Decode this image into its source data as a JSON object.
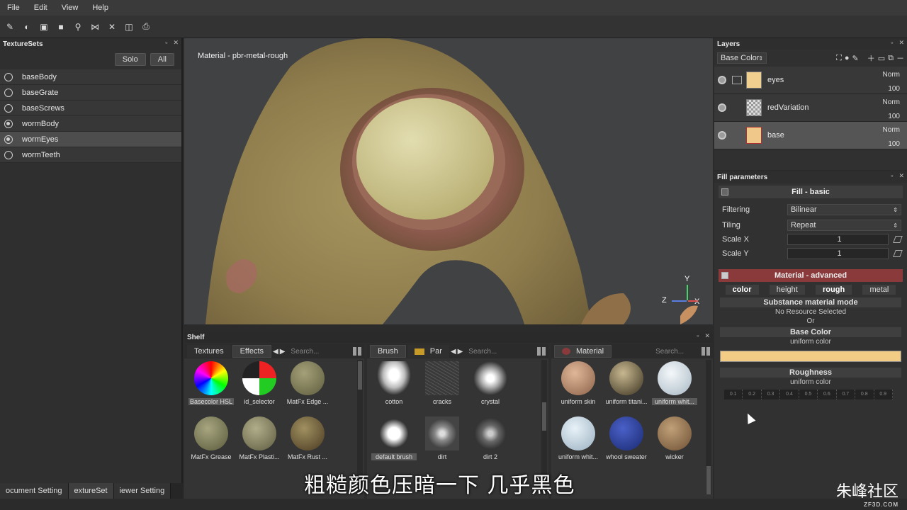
{
  "menu": [
    "File",
    "Edit",
    "View",
    "Help"
  ],
  "texturesets": {
    "title": "TextureSets",
    "solo_label": "Solo",
    "all_label": "All",
    "items": [
      {
        "label": "baseBody",
        "selected": false,
        "checked": false
      },
      {
        "label": "baseGrate",
        "selected": false,
        "checked": false
      },
      {
        "label": "baseScrews",
        "selected": false,
        "checked": false
      },
      {
        "label": "wormBody",
        "selected": false,
        "checked": true
      },
      {
        "label": "wormEyes",
        "selected": true,
        "checked": true
      },
      {
        "label": "wormTeeth",
        "selected": false,
        "checked": false
      }
    ]
  },
  "bottom_tabs": [
    "ocument Setting",
    "extureSet",
    "iewer Setting"
  ],
  "viewport": {
    "material_label": "Material - pbr-metal-rough",
    "axes": {
      "x": "X",
      "y": "Y",
      "z": "Z"
    }
  },
  "shelf": {
    "title": "Shelf",
    "col1": {
      "tabs": [
        "Textures",
        "Effects"
      ],
      "search": "Search...",
      "items": [
        "Basecolor HSL",
        "id_selector",
        "MatFx Edge ...",
        "MatFx Grease",
        "MatFx Plasti...",
        "MatFx Rust ..."
      ]
    },
    "col2": {
      "tabs": [
        "Brush",
        "Par"
      ],
      "search": "Search...",
      "items": [
        "cotton",
        "cracks",
        "crystal",
        "default brush",
        "dirt",
        "dirt 2"
      ]
    },
    "col3": {
      "tabs": [
        "Material"
      ],
      "search": "Search...",
      "items": [
        "uniform skin",
        "uniform titani...",
        "uniform whit...",
        "uniform whit...",
        "whool sweater",
        "wicker"
      ]
    }
  },
  "layers": {
    "title": "Layers",
    "channel": "Base Color",
    "rows": [
      {
        "name": "eyes",
        "blend": "Norm",
        "opacity": "100",
        "color": "#f1cf8f",
        "folder": true,
        "selected": false
      },
      {
        "name": "redVariation",
        "blend": "Norm",
        "opacity": "100",
        "color": "checker",
        "folder": false,
        "selected": false
      },
      {
        "name": "base",
        "blend": "Norm",
        "opacity": "100",
        "color": "#f0c98a",
        "folder": false,
        "selected": true
      }
    ]
  },
  "fill": {
    "title": "Fill parameters",
    "basic_title": "Fill - basic",
    "filtering_label": "Filtering",
    "filtering_value": "Bilinear",
    "tiling_label": "Tiling",
    "tiling_value": "Repeat",
    "scalex_label": "Scale X",
    "scalex_value": "1",
    "scaley_label": "Scale Y",
    "scaley_value": "1",
    "adv_title": "Material - advanced",
    "channels": [
      "color",
      "height",
      "rough",
      "metal"
    ],
    "mode_title": "Substance material mode",
    "no_resource": "No Resource Selected",
    "or": "Or",
    "basecolor_title": "Base Color",
    "basecolor_sub": "uniform color",
    "basecolor_hex": "#f2cc85",
    "roughness_title": "Roughness",
    "roughness_sub": "uniform color",
    "roughness_ticks": [
      "0.1",
      "0.2",
      "0.3",
      "0.4",
      "0.5",
      "0.6",
      "0.7",
      "0.8",
      "0.9"
    ]
  },
  "subtitle": "粗糙颜色压暗一下 几乎黑色",
  "watermark": {
    "big": "朱峰社区",
    "small": "ZF3D.COM"
  }
}
